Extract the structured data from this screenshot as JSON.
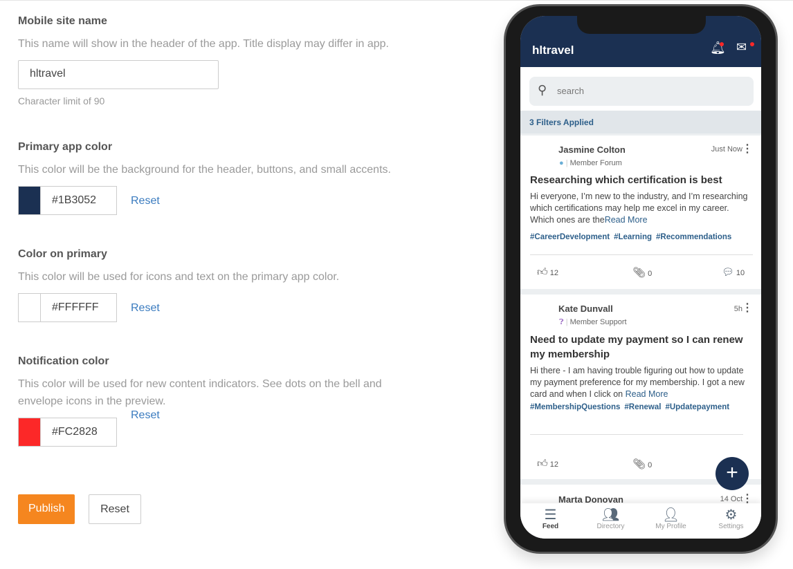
{
  "settings": {
    "site_name": {
      "label": "Mobile site name",
      "desc": "This name will show in the header of the app. Title display may differ in app.",
      "value": "hltravel",
      "hint": "Character limit of 90"
    },
    "primary": {
      "label": "Primary app color",
      "desc": "This color will be the background for the header, buttons, and small accents.",
      "value": "#1B3052",
      "reset": "Reset"
    },
    "on_primary": {
      "label": "Color on primary",
      "desc": "This color will be used for icons and text on the primary app color.",
      "value": "#FFFFFF",
      "reset": "Reset"
    },
    "notification": {
      "label": "Notification color",
      "desc": "This color will be used for new content indicators. See dots on the bell and envelope icons in the preview.",
      "value": "#FC2828",
      "reset": "Reset"
    },
    "publish": "Publish",
    "reset": "Reset"
  },
  "preview": {
    "title": "hltravel",
    "search_placeholder": "search",
    "filters": "3 Filters Applied",
    "posts": [
      {
        "author": "Jasmine Colton",
        "time": "Just Now",
        "category": "Member Forum",
        "title": "Researching which certification is best",
        "body": "Hi everyone, I’m new to the industry, and I’m researching which certifications may help me excel in my career. Which ones are the",
        "read_more": "Read More",
        "tags": [
          "#CareerDevelopment",
          "#Learning",
          "#Recommendations"
        ],
        "likes": "12",
        "attachments": "0",
        "comments": "10"
      },
      {
        "author": "Kate Dunvall",
        "time": "5h",
        "category": "Member Support",
        "title": "Need to update my payment so I can renew my membership",
        "body": "Hi there - I am having trouble figuring out how to update my payment preference for my membership. I got a new card and when I click on",
        "read_more": "Read More",
        "tags": [
          "#MembershipQuestions",
          "#Renewal",
          "#Updatepayment"
        ],
        "likes": "12",
        "attachments": "0"
      },
      {
        "author": "Marta Donovan",
        "time": "14 Oct"
      }
    ],
    "nav": [
      "Feed",
      "Directory",
      "My Profile",
      "Settings"
    ]
  }
}
